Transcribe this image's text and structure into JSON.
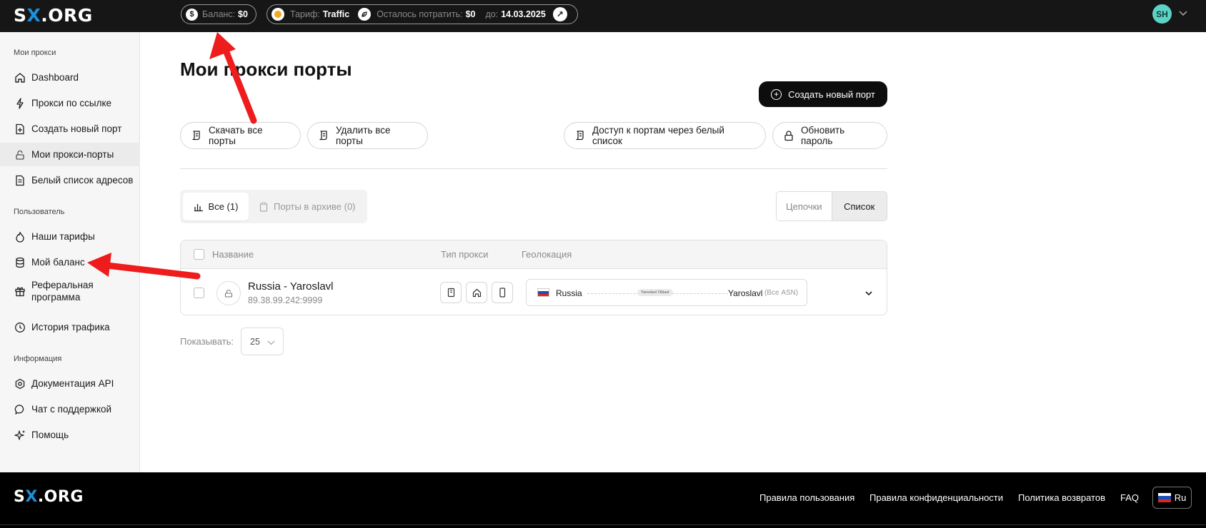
{
  "header": {
    "logo_pre": "S",
    "logo_x": "X",
    "logo_post": ".ORG",
    "balance_label": "Баланс:",
    "balance_value": "$0",
    "plan_label": "Тариф:",
    "plan_value": "Traffic",
    "spend_label": "Осталось потратить:",
    "spend_value": "$0",
    "until_label": "до:",
    "until_value": "14.03.2025",
    "user_initials": "SH"
  },
  "sidebar": {
    "sections": [
      {
        "title": "Мои прокси",
        "items": [
          {
            "label": "Dashboard",
            "icon": "home-icon"
          },
          {
            "label": "Прокси по ссылке",
            "icon": "plug-icon"
          },
          {
            "label": "Создать новый порт",
            "icon": "file-plus-icon"
          },
          {
            "label": "Мои прокси-порты",
            "icon": "lock-icon",
            "active": true
          },
          {
            "label": "Белый список адресов",
            "icon": "list-doc-icon"
          }
        ]
      },
      {
        "title": "Пользователь",
        "items": [
          {
            "label": "Наши тарифы",
            "icon": "flame-icon"
          },
          {
            "label": "Мой баланс",
            "icon": "database-icon"
          },
          {
            "label": "Реферальная программа",
            "icon": "gift-icon"
          },
          {
            "label": "История трафика",
            "icon": "clock-icon"
          }
        ]
      },
      {
        "title": "Информация",
        "items": [
          {
            "label": "Документация API",
            "icon": "gear-icon"
          },
          {
            "label": "Чат с поддержкой",
            "icon": "chat-icon"
          },
          {
            "label": "Помощь",
            "icon": "sparkle-icon"
          }
        ]
      }
    ]
  },
  "main": {
    "title": "Мои прокси порты",
    "create_port_label": "Создать новый порт",
    "download_all_label": "Скачать все порты",
    "delete_all_label": "Удалить все порты",
    "whitelist_access_label": "Доступ к портам через белый список",
    "update_password_label": "Обновить пароль",
    "tabs": [
      {
        "label": "Все (1)",
        "active": true
      },
      {
        "label": "Порты в архиве (0)",
        "active": false
      }
    ],
    "view_modes": [
      "Цепочки",
      "Список"
    ],
    "view_active": "Список",
    "table": {
      "columns": [
        "Название",
        "Тип прокси",
        "Геолокация"
      ],
      "rows": [
        {
          "name": "Russia - Yaroslavl",
          "address": "89.38.99.242:9999",
          "country": "Russia",
          "region": "Yaroslavl Oblast",
          "city": "Yaroslavl",
          "asn": "(Все ASN)"
        }
      ]
    },
    "page_size_label": "Показывать:",
    "page_size_value": "25"
  },
  "footer": {
    "links": [
      "Правила пользования",
      "Правила конфиденциальности",
      "Политика возвратов",
      "FAQ"
    ],
    "language": "Ru"
  },
  "colors": {
    "accent_x": "#1e8fd8",
    "avatar_bg": "#5dd3c5",
    "annotation_arrow": "#ee1c1c"
  }
}
